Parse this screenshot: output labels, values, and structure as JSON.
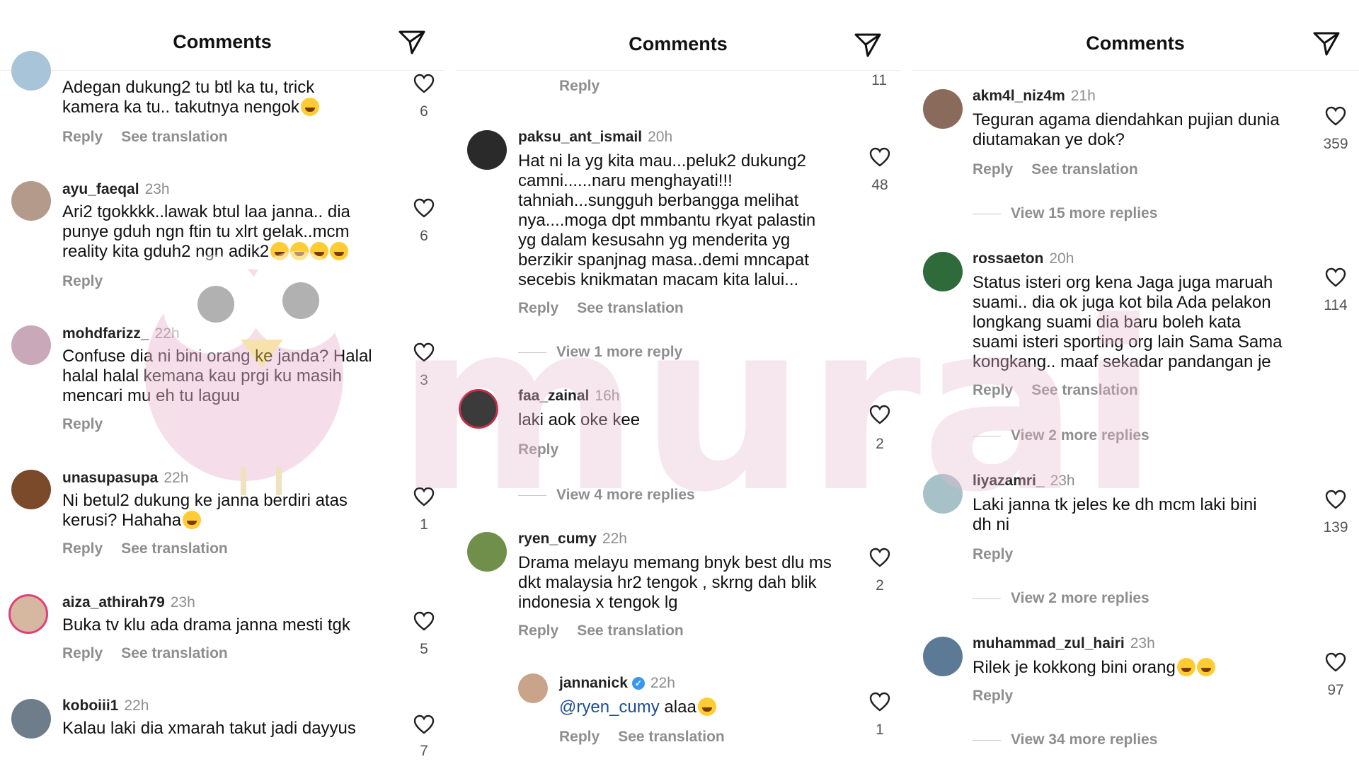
{
  "panels": [
    {
      "title": "Comments",
      "comments": [
        {
          "user": "",
          "time": "",
          "text": "Adegan dukung2 tu btl ka tu, trick\nkamera ka tu.. takutnya nengok",
          "emoji": true,
          "actions": [
            "Reply",
            "See translation"
          ],
          "likes": "6",
          "avatar": "#a8c4d8"
        },
        {
          "user": "ayu_faeqal",
          "time": "23h",
          "text": "Ari2 tgokkkk..lawak btul laa janna.. dia\npunye gduh ngn ftin tu xlrt gelak..mcm\nreality kita gduh2 ngn adik2",
          "actions": [
            "Reply"
          ],
          "likes": "6",
          "avatar": "#b39a8a"
        },
        {
          "user": "mohdfarizz_",
          "time": "22h",
          "text": "Confuse dia ni bini orang ke janda? Halal\nhalal halal kemana kau prgi ku masih\nmencari mu eh tu laguu",
          "actions": [
            "Reply"
          ],
          "likes": "3",
          "avatar": "#c9a9b9"
        },
        {
          "user": "unasupasupa",
          "time": "22h",
          "text": "Ni betul2 dukung ke janna berdiri atas\nkerusi? Hahaha",
          "emoji": true,
          "actions": [
            "Reply",
            "See translation"
          ],
          "likes": "1",
          "avatar": "#7a4a2a"
        },
        {
          "user": "aiza_athirah79",
          "time": "23h",
          "text": "Buka tv klu ada drama janna mesti tgk",
          "actions": [
            "Reply",
            "See translation"
          ],
          "likes": "5",
          "avatar": "#d6b8a0"
        },
        {
          "user": "koboiii1",
          "time": "22h",
          "text": "Kalau laki dia xmarah takut jadi dayyus",
          "actions": [],
          "likes": "7",
          "avatar": "#6f7d8a"
        }
      ]
    },
    {
      "title": "Comments",
      "top": {
        "reply": "Reply",
        "likes": "11"
      },
      "comments": [
        {
          "user": "paksu_ant_ismail",
          "time": "20h",
          "text": "Hat ni la yg kita mau...peluk2 dukung2\ncamni......naru menghayati!!!\ntahniah...sungguh berbangga melihat\nnya....moga dpt mmbantu rkyat palastin\nyg dalam kesusahn yg menderita yg\nberzikir spanjnag masa..demi mncapat\nsecebis knikmatan macam kita lalui...",
          "actions": [
            "Reply",
            "See translation"
          ],
          "likes": "48",
          "avatar": "#2a2a2a"
        },
        {
          "user": "faa_zainal",
          "time": "16h",
          "text": "laki aok oke kee",
          "actions": [
            "Reply"
          ],
          "likes": "2",
          "avatar": "#3b3b3b"
        },
        {
          "user": "ryen_cumy",
          "time": "22h",
          "text": "Drama melayu memang bnyk best dlu ms\ndkt malaysia hr2 tengok , skrng dah blik\nindonesia x tengok lg",
          "actions": [
            "Reply",
            "See translation"
          ],
          "likes": "2",
          "avatar": "#6f8f4a"
        },
        {
          "user": "jannanick",
          "time": "22h",
          "mention": "@ryen_cumy",
          "text": " alaa",
          "actions": [
            "Reply",
            "See translation"
          ],
          "likes": "1",
          "avatar": "#c9a38a"
        }
      ],
      "view_more": [
        "View 1 more reply",
        "View 4 more replies"
      ]
    },
    {
      "title": "Comments",
      "comments": [
        {
          "user": "akm4l_niz4m",
          "time": "21h",
          "text": "Teguran agama diendahkan pujian dunia\ndiutamakan ye dok?",
          "actions": [
            "Reply",
            "See translation"
          ],
          "likes": "359",
          "avatar": "#8a6a5a"
        },
        {
          "user": "rossaeton",
          "time": "20h",
          "text": "Status isteri org kena Jaga juga maruah\nsuami.. dia ok juga kot bila Ada pelakon\nlongkang suami dia baru boleh kata\nsuami isteri sporting org lain Sama Sama\nkongkang.. maaf sekadar pandangan je",
          "actions": [
            "Reply",
            "See translation"
          ],
          "likes": "114",
          "avatar": "#2f6b3a"
        },
        {
          "user": "liyazamri_",
          "time": "23h",
          "text": "Laki janna tk jeles ke dh mcm laki bini\ndh ni",
          "actions": [
            "Reply"
          ],
          "likes": "139",
          "avatar": "#a6c2c8"
        },
        {
          "user": "muhammad_zul_hairi",
          "time": "23h",
          "text": "Rilek je kokkong bini orang",
          "actions": [
            "Reply"
          ],
          "likes": "97",
          "avatar": "#5c7a96"
        }
      ],
      "view_more": [
        "View 15 more replies",
        "View 2 more replies",
        "View 2 more replies",
        "View 34 more replies"
      ]
    }
  ],
  "watermark": "murai",
  "colors": {
    "muted": "#8e8e8e",
    "mention": "#1c4e96",
    "verified": "#3897f0",
    "watermark": "#e8b8cc"
  }
}
